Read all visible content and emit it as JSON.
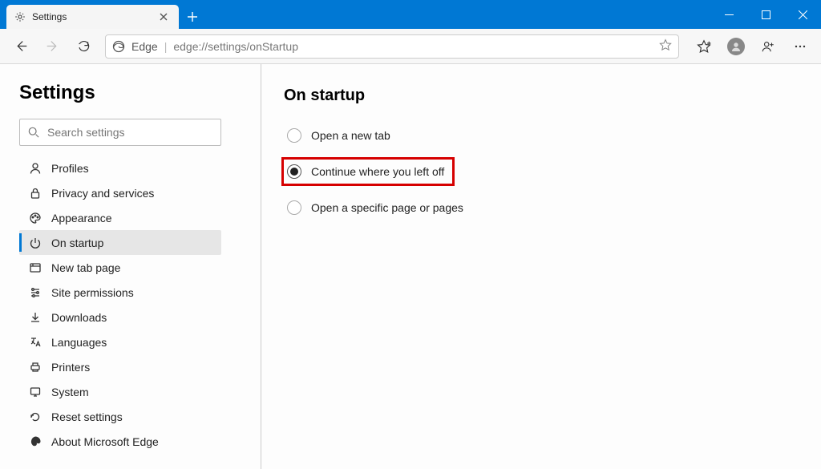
{
  "tab": {
    "title": "Settings"
  },
  "toolbar": {
    "edge_label": "Edge",
    "url": "edge://settings/onStartup"
  },
  "sidebar": {
    "title": "Settings",
    "search_placeholder": "Search settings",
    "items": [
      {
        "label": "Profiles"
      },
      {
        "label": "Privacy and services"
      },
      {
        "label": "Appearance"
      },
      {
        "label": "On startup"
      },
      {
        "label": "New tab page"
      },
      {
        "label": "Site permissions"
      },
      {
        "label": "Downloads"
      },
      {
        "label": "Languages"
      },
      {
        "label": "Printers"
      },
      {
        "label": "System"
      },
      {
        "label": "Reset settings"
      },
      {
        "label": "About Microsoft Edge"
      }
    ],
    "active_index": 3
  },
  "content": {
    "heading": "On startup",
    "options": [
      {
        "label": "Open a new tab",
        "selected": false
      },
      {
        "label": "Continue where you left off",
        "selected": true,
        "highlighted": true
      },
      {
        "label": "Open a specific page or pages",
        "selected": false
      }
    ]
  }
}
